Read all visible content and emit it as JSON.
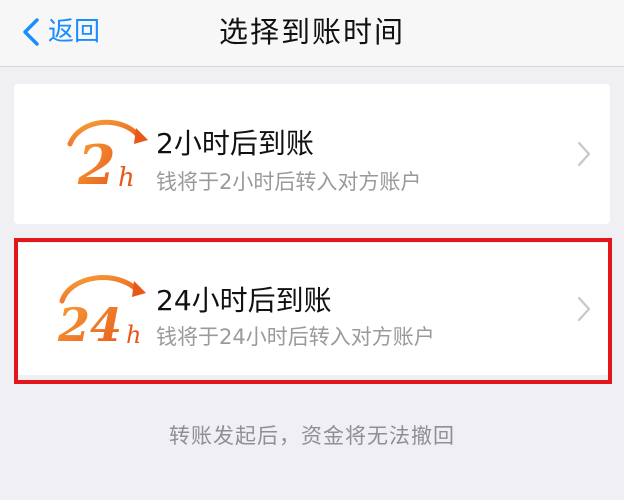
{
  "navbar": {
    "back_label": "返回",
    "title": "选择到账时间"
  },
  "options": [
    {
      "icon_text": "2",
      "icon_suffix": "h",
      "title": "2小时后到账",
      "description": "钱将于2小时后转入对方账户",
      "selected": false
    },
    {
      "icon_text": "24",
      "icon_suffix": "h",
      "title": "24小时后到账",
      "description": "钱将于24小时后转入对方账户",
      "selected": true
    }
  ],
  "footer": {
    "note": "转账发起后，资金将无法撤回"
  },
  "colors": {
    "accent": "#1a8cff",
    "icon_orange": "#f0741e",
    "highlight_red": "#e3161b",
    "background": "#efeff4"
  },
  "icons": {
    "back": "chevron-left-icon",
    "row_arrow": "chevron-right-icon",
    "option_badge": "clock-badge-icon"
  }
}
